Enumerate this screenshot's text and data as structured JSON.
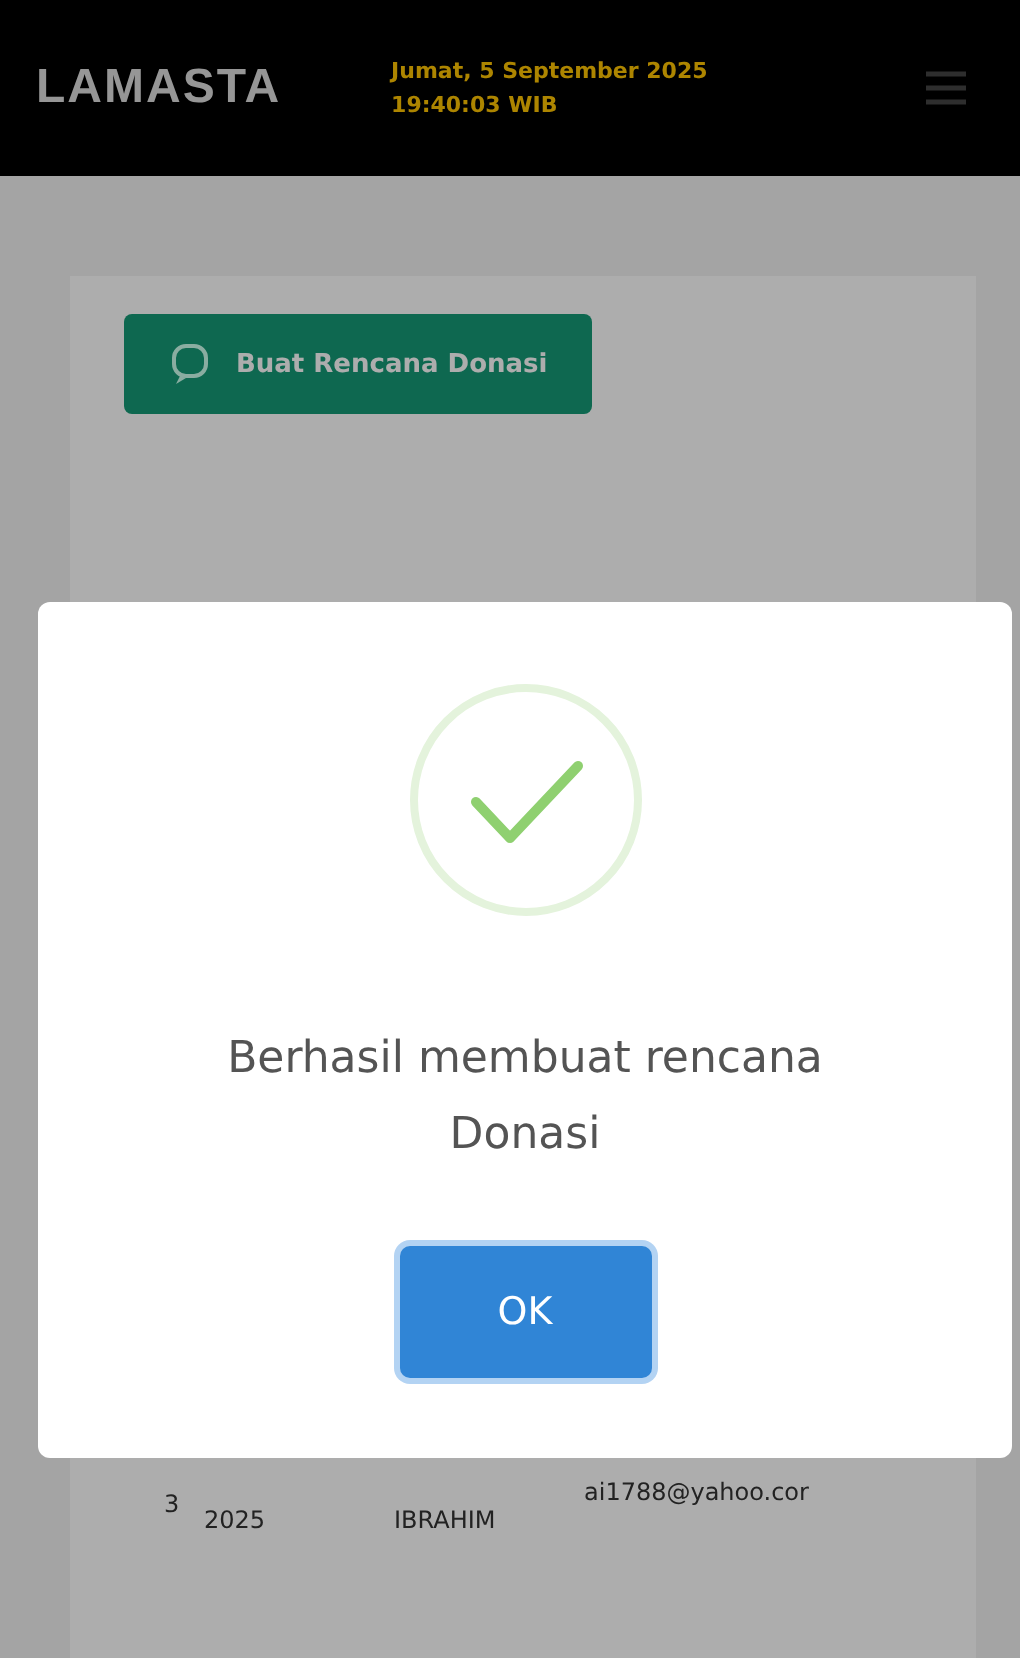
{
  "header": {
    "logo": "LAMASTA",
    "date": "Jumat, 5 September 2025",
    "time": "19:40:03 WIB"
  },
  "create_button": {
    "label": "Buat Rencana Donasi"
  },
  "table": {
    "rows": [
      {
        "number": "3",
        "date": "2025",
        "name": "IBRAHIM",
        "email": "ai1788@yahoo.cor"
      }
    ]
  },
  "dialog": {
    "kind": "success",
    "message": "Berhasil membuat rencana Donasi",
    "button": "OK"
  }
}
